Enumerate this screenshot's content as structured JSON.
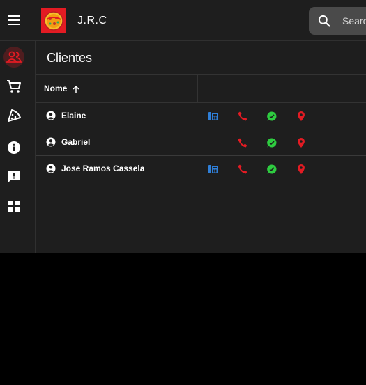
{
  "header": {
    "app_title": "J.R.C",
    "search_placeholder": "Search"
  },
  "page": {
    "title": "Clientes"
  },
  "table": {
    "column_name": "Nome",
    "rows": [
      {
        "name": "Elaine",
        "has_landline": true
      },
      {
        "name": "Gabriel",
        "has_landline": false
      },
      {
        "name": "Jose Ramos Cassela",
        "has_landline": true
      }
    ]
  },
  "sidebar": {
    "items": [
      {
        "icon": "users-icon",
        "active": true
      },
      {
        "icon": "cart-icon",
        "active": false
      },
      {
        "icon": "pizza-icon",
        "active": false
      },
      {
        "icon": "info-icon",
        "active": false
      },
      {
        "icon": "feedback-icon",
        "active": false
      },
      {
        "icon": "dashboard-icon",
        "active": false
      }
    ]
  },
  "colors": {
    "accent": "#e31b23",
    "landline_icon": "#2f7fd8",
    "call_icon": "#e31b23",
    "whatsapp_icon": "#2ecc40",
    "map_icon": "#e31b23",
    "background": "#1e1e1e"
  }
}
